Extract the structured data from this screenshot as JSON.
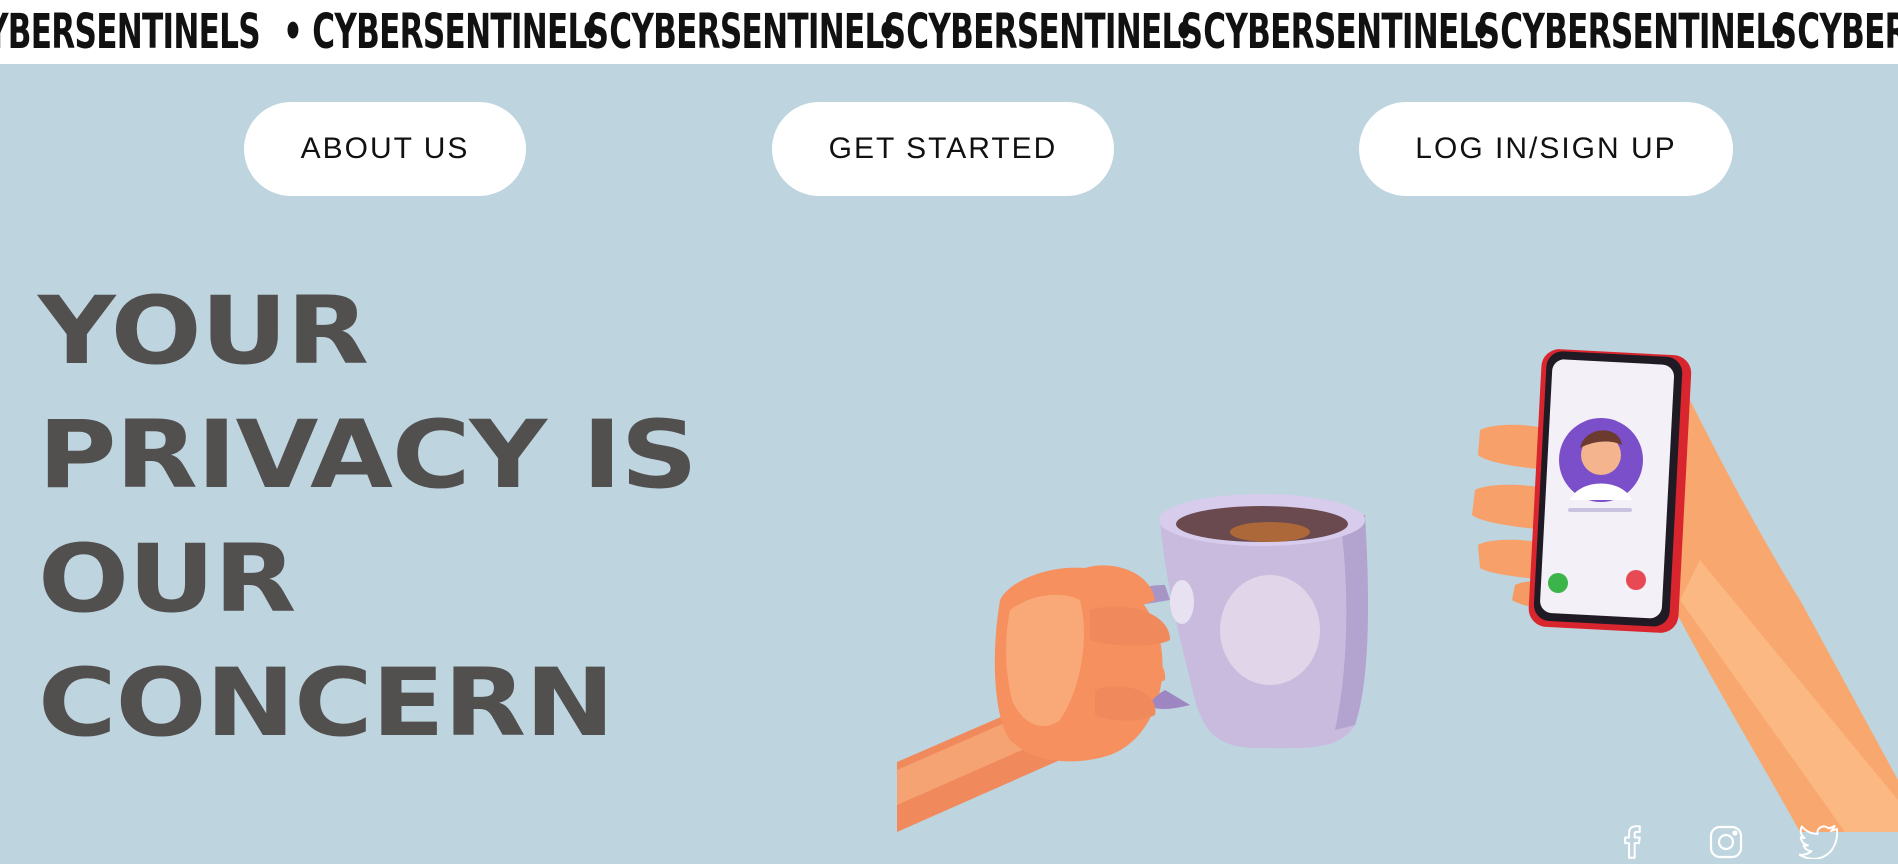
{
  "ticker": {
    "items": [
      "YBERSENTINELS",
      "• CYBERSENTINELS",
      "• CYBERSENTINELS",
      "• CYBERSENTINELS",
      "• CYBERSENTINELS",
      "• CYBERSENTINELS",
      "• CYBERSEN"
    ]
  },
  "nav": {
    "about": "ABOUT US",
    "start": "GET STARTED",
    "login": "LOG IN/SIGN UP"
  },
  "hero": {
    "lines": [
      "YOUR",
      "PRIVACY IS",
      "OUR",
      "CONCERN"
    ]
  },
  "social": {
    "icons": [
      "facebook-icon",
      "instagram-icon",
      "twitter-icon"
    ]
  },
  "colors": {
    "background": "#bed4df",
    "headline": "#524f4f",
    "button": "#ffffff"
  }
}
